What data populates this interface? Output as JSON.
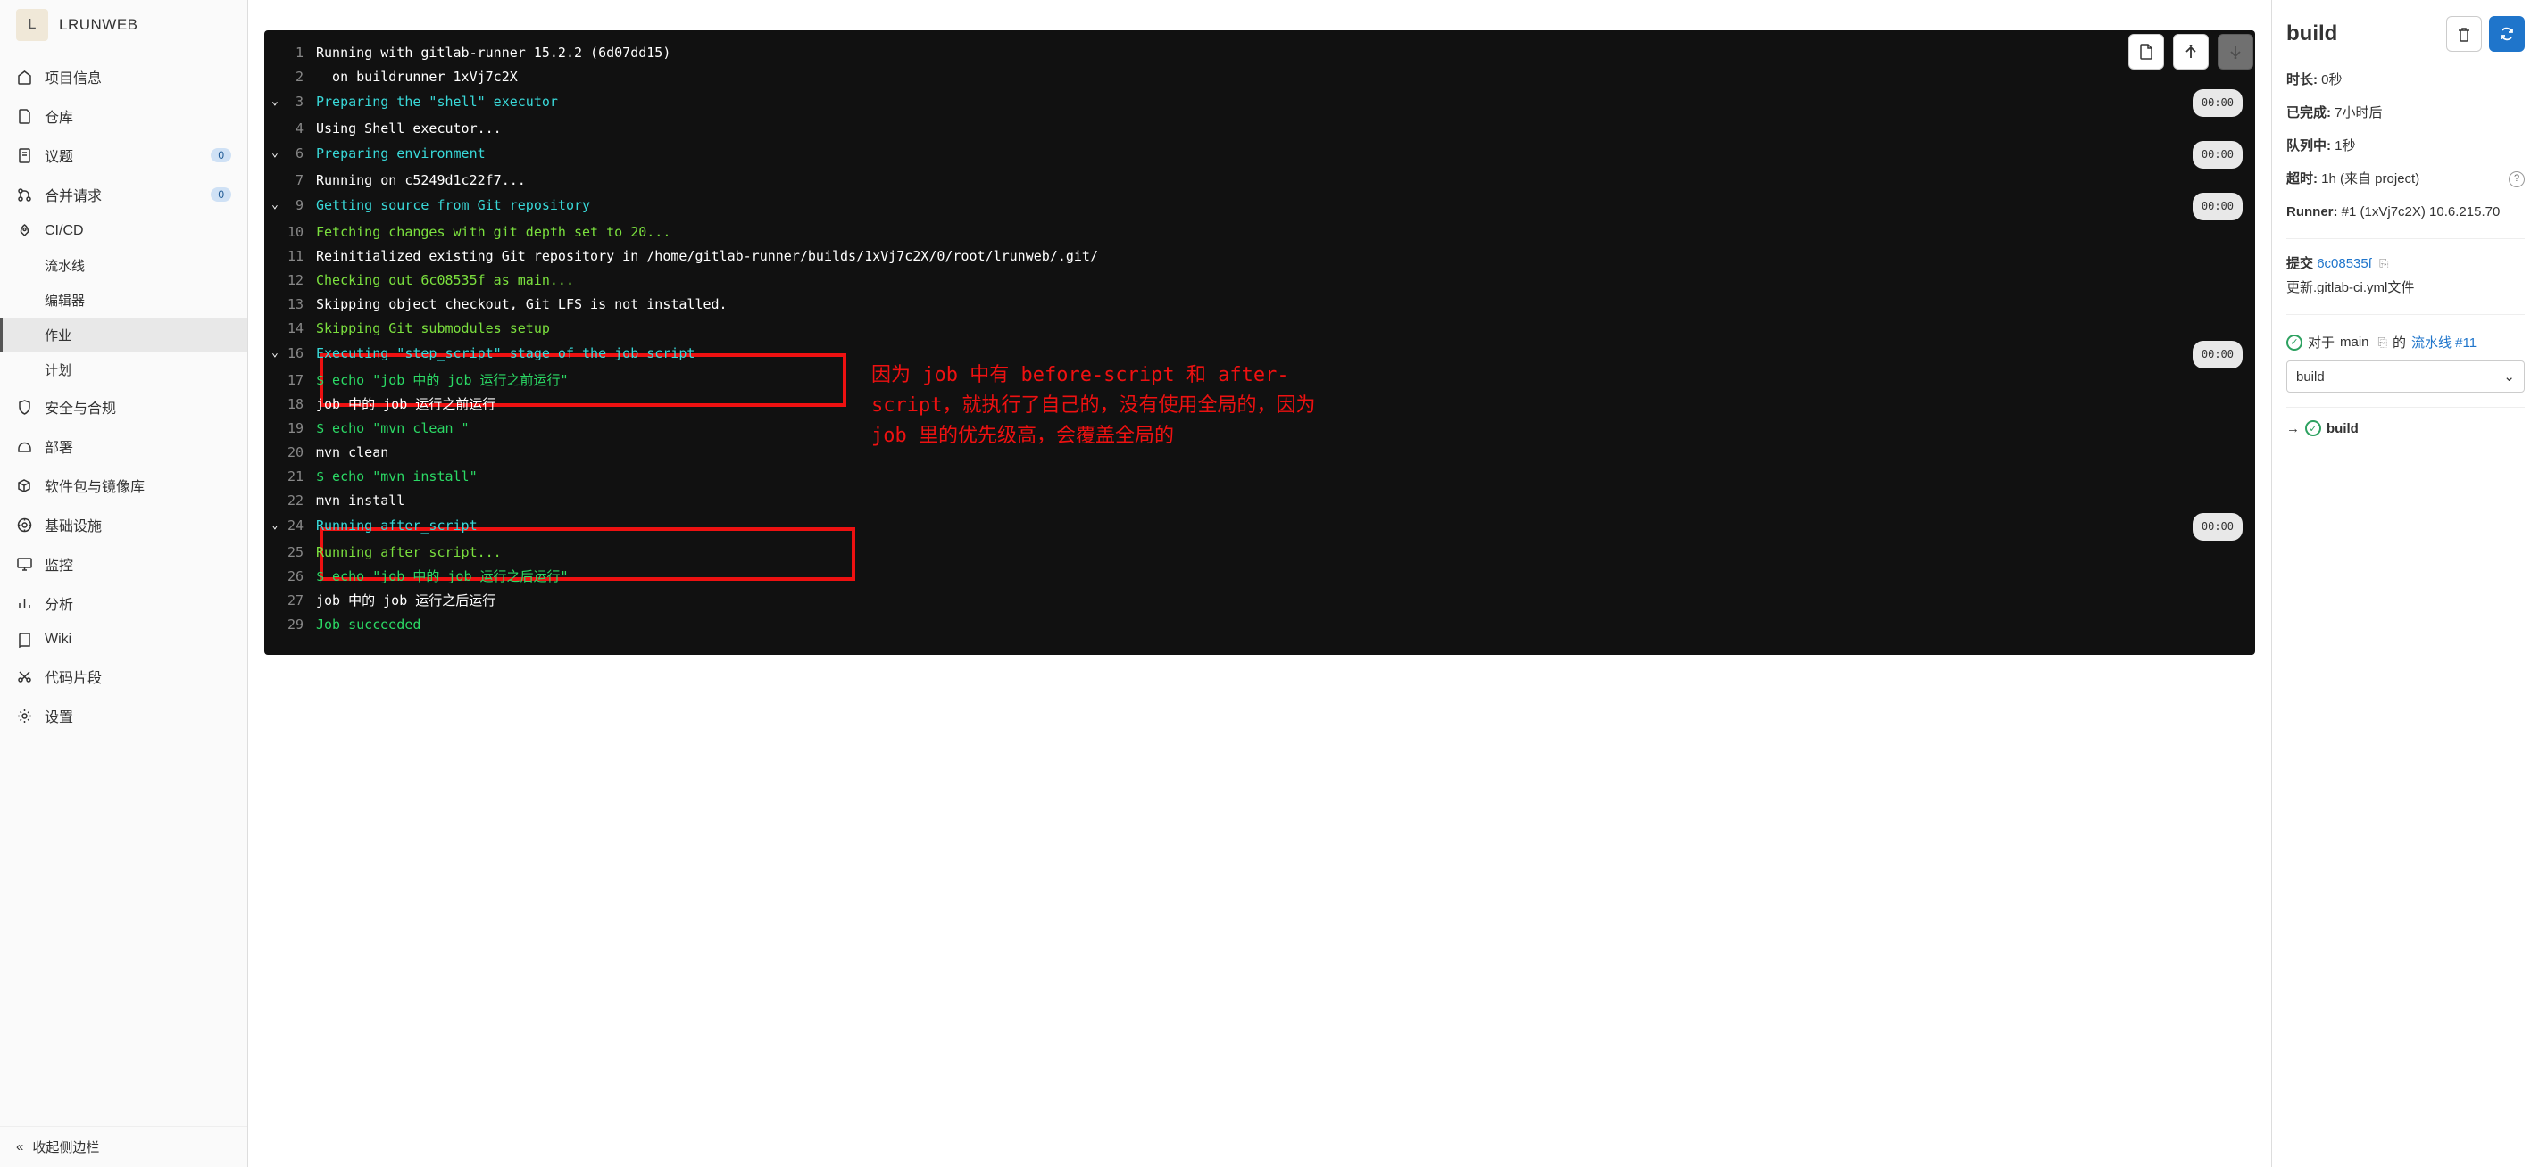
{
  "sidebar": {
    "avatar_letter": "L",
    "project_name": "LRUNWEB",
    "items": [
      {
        "icon": "home",
        "label": "项目信息"
      },
      {
        "icon": "repo",
        "label": "仓库"
      },
      {
        "icon": "issue",
        "label": "议题",
        "badge": "0"
      },
      {
        "icon": "merge",
        "label": "合并请求",
        "badge": "0"
      },
      {
        "icon": "rocket",
        "label": "CI/CD"
      },
      {
        "icon": "shield",
        "label": "安全与合规"
      },
      {
        "icon": "deploy",
        "label": "部署"
      },
      {
        "icon": "package",
        "label": "软件包与镜像库"
      },
      {
        "icon": "infra",
        "label": "基础设施"
      },
      {
        "icon": "monitor",
        "label": "监控"
      },
      {
        "icon": "analytics",
        "label": "分析"
      },
      {
        "icon": "wiki",
        "label": "Wiki"
      },
      {
        "icon": "snippet",
        "label": "代码片段"
      },
      {
        "icon": "settings",
        "label": "设置"
      }
    ],
    "sub_items": [
      "流水线",
      "编辑器",
      "作业",
      "计划"
    ],
    "active_sub": "作业",
    "collapse": "收起侧边栏"
  },
  "log_lines": [
    {
      "n": 1,
      "cls": "c-white",
      "txt": "Running with gitlab-runner 15.2.2 (6d07dd15)"
    },
    {
      "n": 2,
      "cls": "c-white",
      "txt": "  on buildrunner 1xVj7c2X"
    },
    {
      "n": 3,
      "cls": "c-cyan",
      "txt": "Preparing the \"shell\" executor",
      "chev": true,
      "time": "00:00"
    },
    {
      "n": 4,
      "cls": "c-white",
      "txt": "Using Shell executor..."
    },
    {
      "n": 6,
      "cls": "c-cyan",
      "txt": "Preparing environment",
      "chev": true,
      "time": "00:00"
    },
    {
      "n": 7,
      "cls": "c-white",
      "txt": "Running on c5249d1c22f7..."
    },
    {
      "n": 9,
      "cls": "c-cyan",
      "txt": "Getting source from Git repository",
      "chev": true,
      "time": "00:00"
    },
    {
      "n": 10,
      "cls": "c-lime",
      "txt": "Fetching changes with git depth set to 20..."
    },
    {
      "n": 11,
      "cls": "c-white",
      "txt": "Reinitialized existing Git repository in /home/gitlab-runner/builds/1xVj7c2X/0/root/lrunweb/.git/"
    },
    {
      "n": 12,
      "cls": "c-lime",
      "txt": "Checking out 6c08535f as main..."
    },
    {
      "n": 13,
      "cls": "c-white",
      "txt": "Skipping object checkout, Git LFS is not installed."
    },
    {
      "n": 14,
      "cls": "c-lime",
      "txt": "Skipping Git submodules setup"
    },
    {
      "n": 16,
      "cls": "c-cyan",
      "txt": "Executing \"step_script\" stage of the job script",
      "chev": true,
      "time": "00:00"
    },
    {
      "n": 17,
      "cls": "c-green",
      "txt": "$ echo \"job 中的 job 运行之前运行\""
    },
    {
      "n": 18,
      "cls": "c-white",
      "txt": "job 中的 job 运行之前运行"
    },
    {
      "n": 19,
      "cls": "c-green",
      "txt": "$ echo \"mvn clean \""
    },
    {
      "n": 20,
      "cls": "c-white",
      "txt": "mvn clean"
    },
    {
      "n": 21,
      "cls": "c-green",
      "txt": "$ echo \"mvn install\""
    },
    {
      "n": 22,
      "cls": "c-white",
      "txt": "mvn install"
    },
    {
      "n": 24,
      "cls": "c-cyan",
      "txt": "Running after_script",
      "chev": true,
      "time": "00:00"
    },
    {
      "n": 25,
      "cls": "c-lime",
      "txt": "Running after script..."
    },
    {
      "n": 26,
      "cls": "c-green",
      "txt": "$ echo \"job 中的 job 运行之后运行\""
    },
    {
      "n": 27,
      "cls": "c-white",
      "txt": "job 中的 job 运行之后运行"
    },
    {
      "n": 29,
      "cls": "c-green",
      "txt": "Job succeeded"
    }
  ],
  "annotation": "因为 job 中有 before-script 和 after-script，就执行了自己的，没有使用全局的，因为 job 里的优先级高，会覆盖全局的",
  "details": {
    "title": "build",
    "duration_label": "时长:",
    "duration_value": "0秒",
    "finished_label": "已完成:",
    "finished_value": "7小时后",
    "queued_label": "队列中:",
    "queued_value": "1秒",
    "timeout_label": "超时:",
    "timeout_value": "1h (来自 project)",
    "runner_label": "Runner:",
    "runner_value": "#1 (1xVj7c2X) 10.6.215.70",
    "commit_label": "提交",
    "commit_hash": "6c08535f",
    "commit_msg": "更新.gitlab-ci.yml文件",
    "pipeline_prefix": "对于",
    "pipeline_branch": "main",
    "pipeline_mid": "的",
    "pipeline_link": "流水线 #11",
    "stage_selected": "build",
    "job_name": "build"
  }
}
